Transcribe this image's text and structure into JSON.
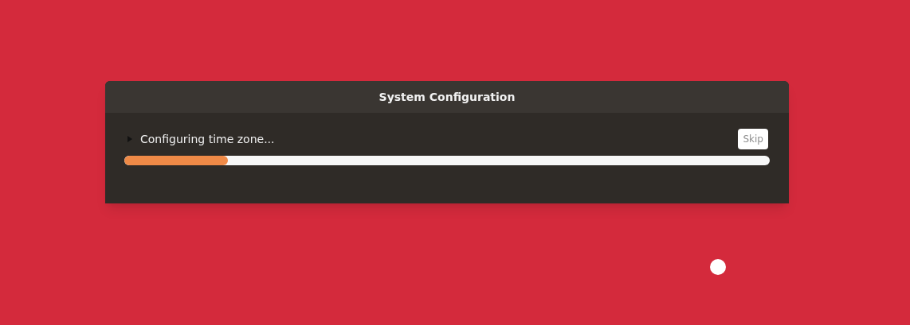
{
  "dialog": {
    "title": "System Configuration",
    "status": {
      "text": "Configuring time zone...",
      "expanded": false
    },
    "skip_button": {
      "label": "Skip",
      "disabled": true
    },
    "progress": {
      "level": 0.16
    }
  }
}
